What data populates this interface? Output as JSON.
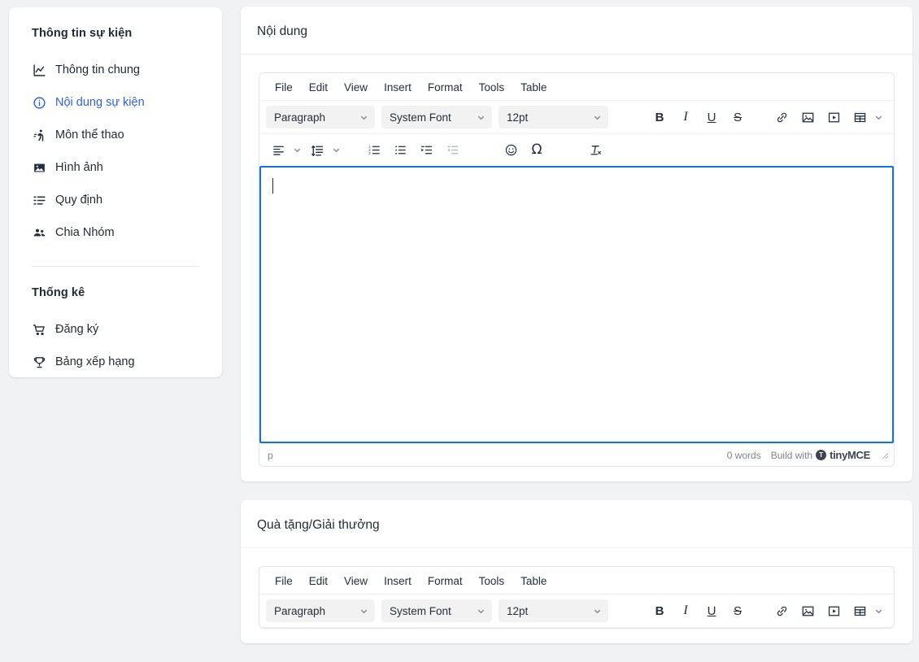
{
  "sidebar": {
    "section1_title": "Thông tin sự kiện",
    "items": [
      {
        "label": "Thông tin chung",
        "icon": "chart-line-icon",
        "active": false
      },
      {
        "label": "Nội dung sự kiện",
        "icon": "info-circle-icon",
        "active": true
      },
      {
        "label": "Môn thể thao",
        "icon": "running-person-icon",
        "active": false
      },
      {
        "label": "Hình ảnh",
        "icon": "image-icon",
        "active": false
      },
      {
        "label": "Quy định",
        "icon": "list-rules-icon",
        "active": false
      },
      {
        "label": "Chia Nhóm",
        "icon": "users-group-icon",
        "active": false
      }
    ],
    "section2_title": "Thống kê",
    "items2": [
      {
        "label": "Đăng ký",
        "icon": "cart-icon",
        "active": false
      },
      {
        "label": "Bảng xếp hạng",
        "icon": "trophy-icon",
        "active": false
      }
    ],
    "active_color": "#2f5fe0"
  },
  "cards": [
    {
      "title": "Nội dung"
    },
    {
      "title": "Quà tặng/Giải thưởng"
    }
  ],
  "editor": {
    "menubar": [
      "File",
      "Edit",
      "View",
      "Insert",
      "Format",
      "Tools",
      "Table"
    ],
    "selects": {
      "block": "Paragraph",
      "font": "System Font",
      "size": "12pt"
    },
    "toolbar_row1": [
      {
        "name": "bold-button",
        "glyph": "B"
      },
      {
        "name": "italic-button",
        "glyph": "I"
      },
      {
        "name": "underline-button",
        "glyph": "U"
      },
      {
        "name": "strikethrough-button",
        "glyph": "S"
      },
      {
        "name": "link-button",
        "glyph": "link-icon"
      },
      {
        "name": "insert-image-button",
        "glyph": "image-icon"
      },
      {
        "name": "insert-media-button",
        "glyph": "media-icon"
      },
      {
        "name": "table-button",
        "glyph": "table-icon"
      }
    ],
    "toolbar_row2": [
      {
        "name": "align-button",
        "glyph": "align-left-icon"
      },
      {
        "name": "line-height-button",
        "glyph": "line-height-icon"
      },
      {
        "name": "numbered-list-button",
        "glyph": "ordered-list-icon"
      },
      {
        "name": "bullet-list-button",
        "glyph": "unordered-list-icon"
      },
      {
        "name": "indent-button",
        "glyph": "indent-icon"
      },
      {
        "name": "outdent-button",
        "glyph": "outdent-icon"
      },
      {
        "name": "emoticon-button",
        "glyph": "emoji-icon"
      },
      {
        "name": "special-character-button",
        "glyph": "omega-icon"
      },
      {
        "name": "clear-formatting-button",
        "glyph": "remove-format-icon"
      }
    ],
    "statusbar": {
      "path": "p",
      "word_count": "0 words",
      "brand_prefix": "Build with",
      "brand_mark": "T",
      "brand_name": "tinyMCE"
    },
    "focus_border_color": "#1472e8"
  }
}
